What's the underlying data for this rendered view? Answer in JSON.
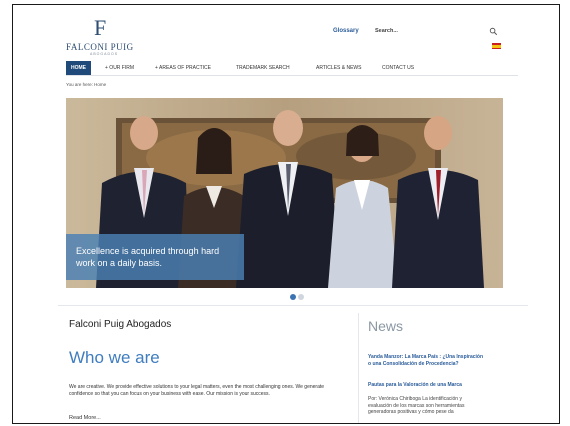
{
  "header": {
    "logo_mark": "F",
    "logo_text": "FALCONI PUIG",
    "logo_sub": "ABOGADOS",
    "glossary_label": "Glossary",
    "search_placeholder": "Search...",
    "language_flag": "es-flag-icon"
  },
  "nav": {
    "items": [
      {
        "label": "HOME",
        "active": true
      },
      {
        "label": "+ OUR FIRM"
      },
      {
        "label": "+ AREAS OF PRACTICE"
      },
      {
        "label": "TRADEMARK SEARCH"
      },
      {
        "label": "ARTICLES & NEWS"
      },
      {
        "label": "CONTACT US"
      }
    ]
  },
  "breadcrumb": "You are here: Home",
  "hero": {
    "caption": "Excellence is acquired through hard work on a daily basis.",
    "slide_count": 2,
    "active_slide": 1
  },
  "main": {
    "firm_title": "Falconi Puig Abogados",
    "section_title": "Who we are",
    "body": "We are creative. We provide effective solutions to your legal matters, even the most challenging ones. We generate confidence so that you can focus on your business with ease. Our mission is your success.",
    "read_more": "Read More..."
  },
  "news": {
    "title": "News",
    "items": [
      {
        "headline": "Yanda Manzor: La Marca País : ¿Una Inspiración o una Consolidación de Procedencia?"
      },
      {
        "headline": "Pautas para la Valoración de una Marca",
        "body": "Por: Verónica Chiriboga La identificación y evaluación de los marcas son herramientas generadoras positivas y cómo pese da"
      }
    ]
  },
  "colors": {
    "brand_blue": "#1f4a7a",
    "link_blue": "#2a5c9a",
    "heading_blue": "#3f7dbf",
    "caption_bg": "#4a80b5"
  }
}
